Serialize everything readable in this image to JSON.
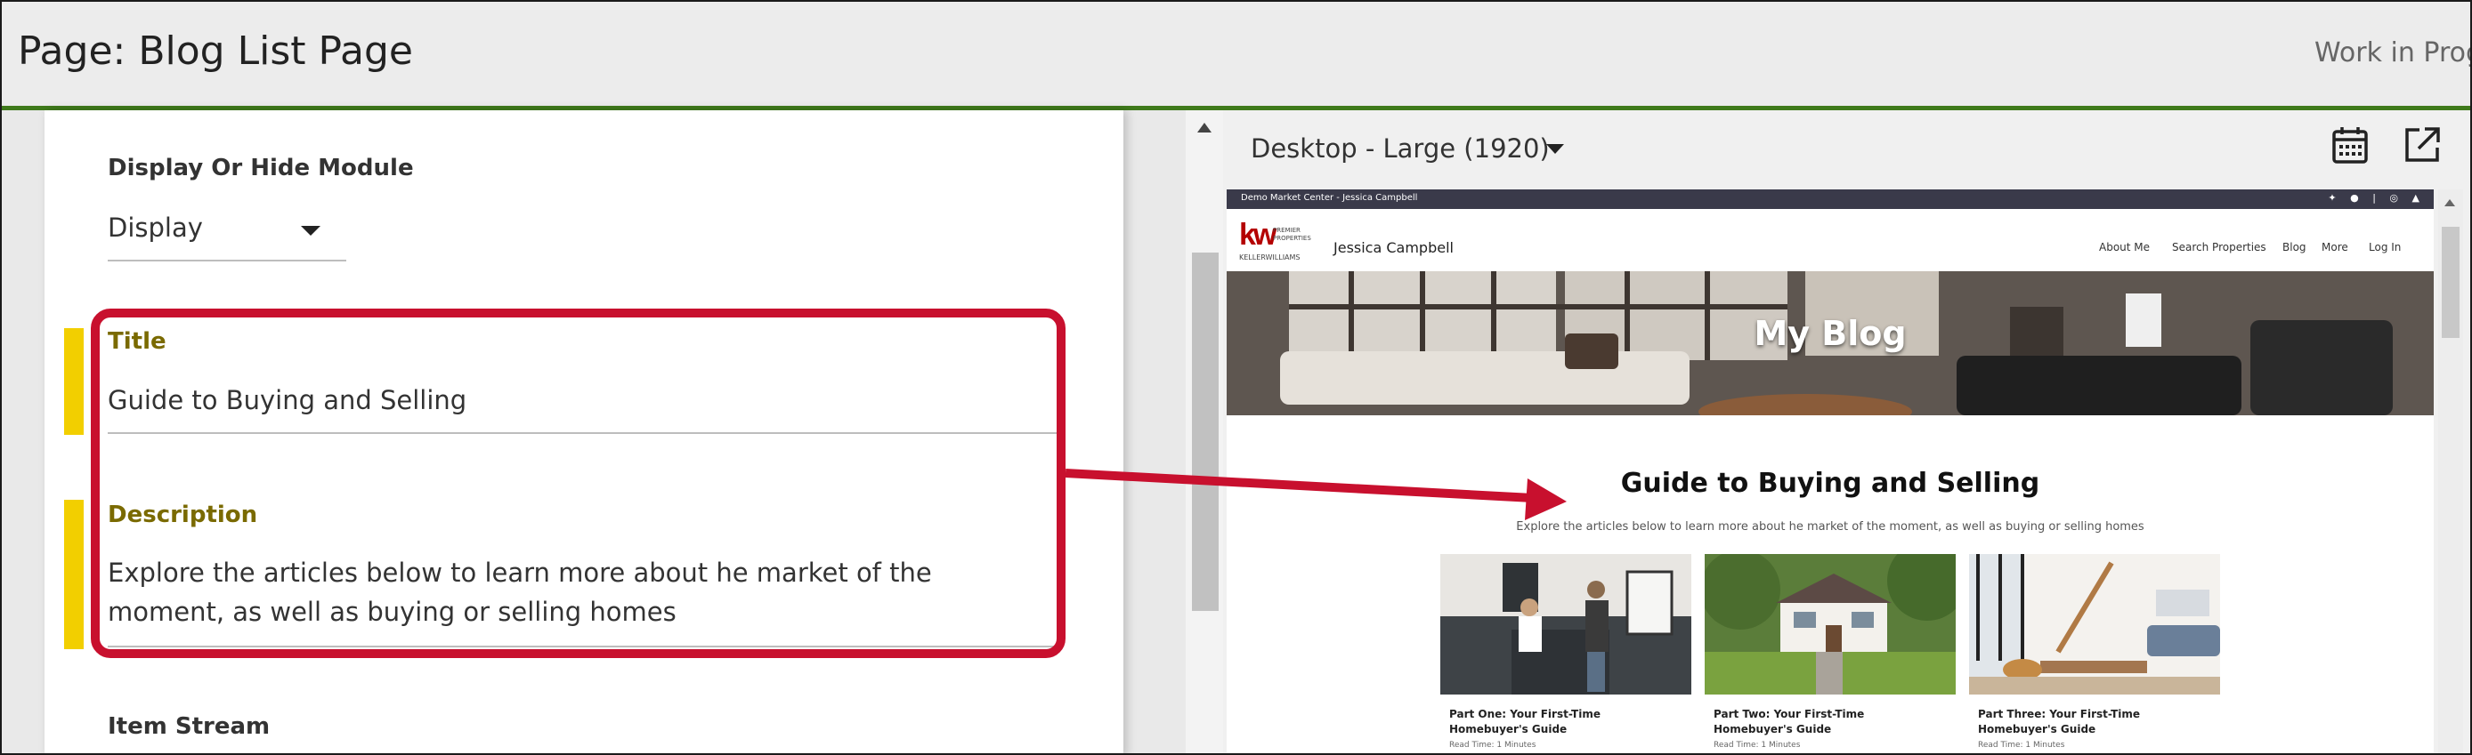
{
  "header": {
    "title": "Page: Blog List Page",
    "status": "Work in Prog"
  },
  "editor": {
    "display_label": "Display Or Hide Module",
    "display_value": "Display",
    "title_label": "Title",
    "title_value": "Guide to Buying and Selling",
    "description_label": "Description",
    "description_value": "Explore the articles below to learn more about he market of the moment, as well as buying or selling homes",
    "item_stream_label": "Item Stream"
  },
  "preview": {
    "device": "Desktop - Large (1920)",
    "icons": [
      "calendar-icon",
      "open-external-icon"
    ]
  },
  "site": {
    "top_strip": "Demo Market Center - Jessica Campbell",
    "logo_lines": [
      "PREMIER",
      "PROPERTIES"
    ],
    "logo_brand": "KELLERWILLIAMS",
    "agent_name": "Jessica Campbell",
    "nav": [
      "About Me",
      "Search Properties",
      "Blog",
      "More",
      "Log In"
    ],
    "hero_title": "My Blog",
    "section_title": "Guide to Buying and Selling",
    "section_description": "Explore the articles below to learn more about he market of the moment, as well as buying or selling homes",
    "cards": [
      {
        "title": "Part One: Your First-Time Homebuyer's Guide",
        "read_time": "Read Time: 1 Minutes"
      },
      {
        "title": "Part Two: Your First-Time Homebuyer's Guide",
        "read_time": "Read Time: 1 Minutes"
      },
      {
        "title": "Part Three: Your First-Time Homebuyer's Guide",
        "read_time": "Read Time: 1 Minutes"
      }
    ]
  },
  "colors": {
    "accent_green": "#3f7a1b",
    "highlight_red": "#c8102e",
    "field_accent_yellow": "#f2cf00",
    "kw_red": "#b40101"
  }
}
